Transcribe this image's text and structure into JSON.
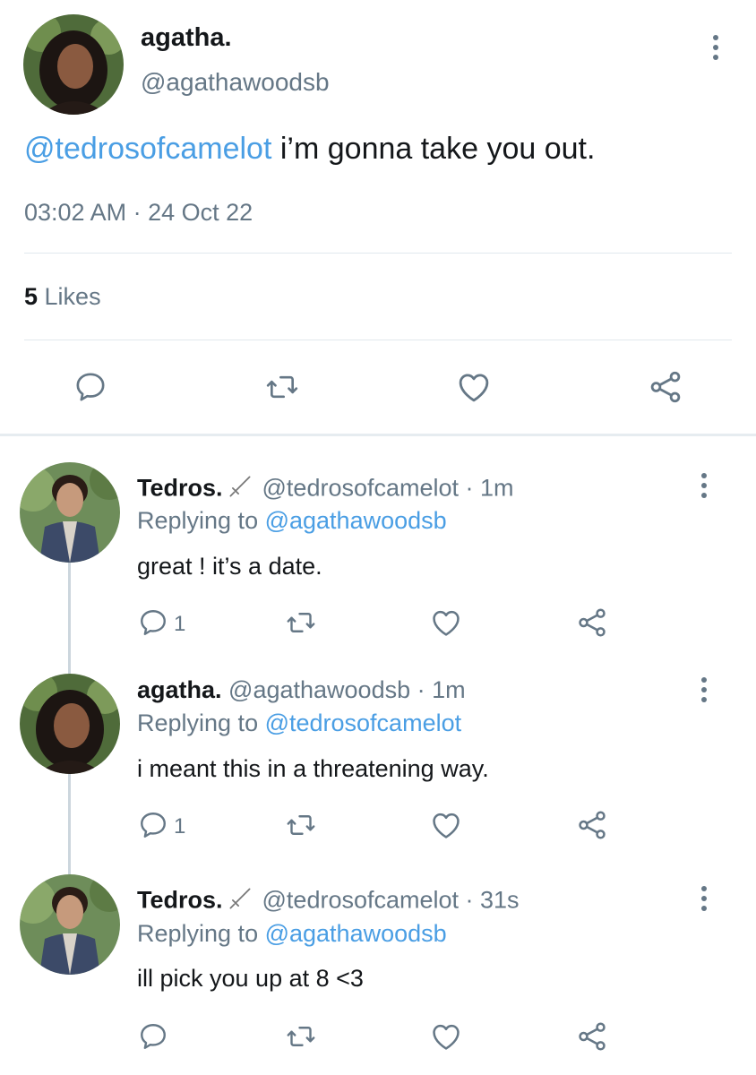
{
  "main_tweet": {
    "display_name": "agatha.",
    "handle": "@agathawoodsb",
    "mention": "@tedrosofcamelot",
    "text": " i’m gonna take you out.",
    "timestamp": "03:02 AM · 24 Oct 22",
    "likes_count": "5",
    "likes_label": " Likes"
  },
  "replies": [
    {
      "display_name": "Tedros.",
      "handle": "@tedrosofcamelot · 1m",
      "replying_prefix": "Replying to ",
      "replying_to": "@agathawoodsb",
      "text": "great ! it’s a date.",
      "reply_count": "1"
    },
    {
      "display_name": "agatha.",
      "handle": "@agathawoodsb · 1m",
      "replying_prefix": "Replying to ",
      "replying_to": "@tedrosofcamelot",
      "text": "i meant this in a threatening way.",
      "reply_count": "1"
    },
    {
      "display_name": "Tedros.",
      "handle": "@tedrosofcamelot · 31s",
      "replying_prefix": "Replying to ",
      "replying_to": "@agathawoodsb",
      "text": "ill pick you up at 8 <3",
      "reply_count": ""
    }
  ],
  "icons": {
    "reply": "speech-bubble-icon",
    "retweet": "retweet-icon",
    "like": "heart-icon",
    "share": "share-icon",
    "more": "more-vertical-icon",
    "sword": "sword-icon"
  },
  "colors": {
    "accent": "#4a9ee4",
    "secondary_text": "#657786",
    "divider": "#e1e8ed"
  }
}
